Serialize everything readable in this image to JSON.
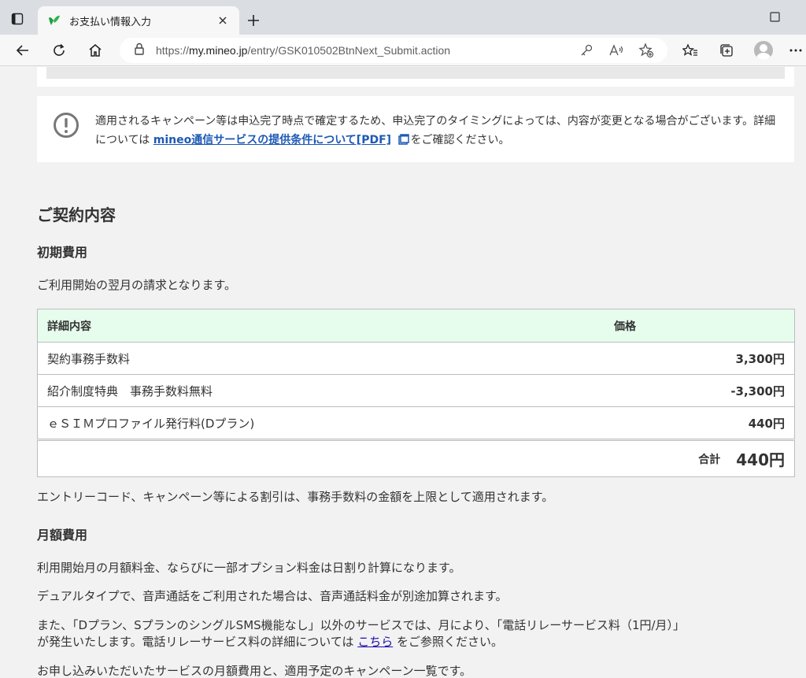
{
  "browser": {
    "tab_title": "お支払い情報入力",
    "url_prefix": "https://",
    "url_host": "my.mineo.jp",
    "url_path": "/entry/GSK010502BtnNext_Submit.action"
  },
  "notice": {
    "text_before": "適用されるキャンペーン等は申込完了時点で確定するため、申込完了のタイミングによっては、内容が変更となる場合がございます。詳細については",
    "link": "mineo通信サービスの提供条件について[PDF]",
    "text_after": "をご確認ください。"
  },
  "contract": {
    "heading": "ご契約内容",
    "initial_heading": "初期費用",
    "initial_note": "ご利用開始の翌月の請求となります。",
    "table": {
      "headers": [
        "詳細内容",
        "価格"
      ],
      "rows": [
        {
          "name": "契約事務手数料",
          "price": "3,300円"
        },
        {
          "name": "紹介制度特典　事務手数料無料",
          "price": "-3,300円"
        },
        {
          "name": "ｅＳＩＭプロファイル発行料(Dプラン)",
          "price": "440円"
        }
      ],
      "total_label": "合計",
      "total_value": "440円"
    },
    "discount_note": "エントリーコード、キャンペーン等による割引は、事務手数料の金額を上限として適用されます。",
    "monthly_heading": "月額費用",
    "monthly_notes": [
      "利用開始月の月額料金、ならびに一部オプション料金は日割り計算になります。",
      "デュアルタイプで、音声通話をご利用された場合は、音声通話料金が別途加算されます。"
    ],
    "relay_line1": "また、「Dプラン、SプランのシングルSMS機能なし」以外のサービスでは、月により、「電話リレーサービス料（1円/月）」",
    "relay_line2_before": "が発生いたします。電話リレーサービス料の詳細については",
    "relay_link": "こちら",
    "relay_line2_after": "をご参照ください。",
    "last_note": "お申し込みいただいたサービスの月額費用と、適用予定のキャンペーン一覧です。"
  }
}
